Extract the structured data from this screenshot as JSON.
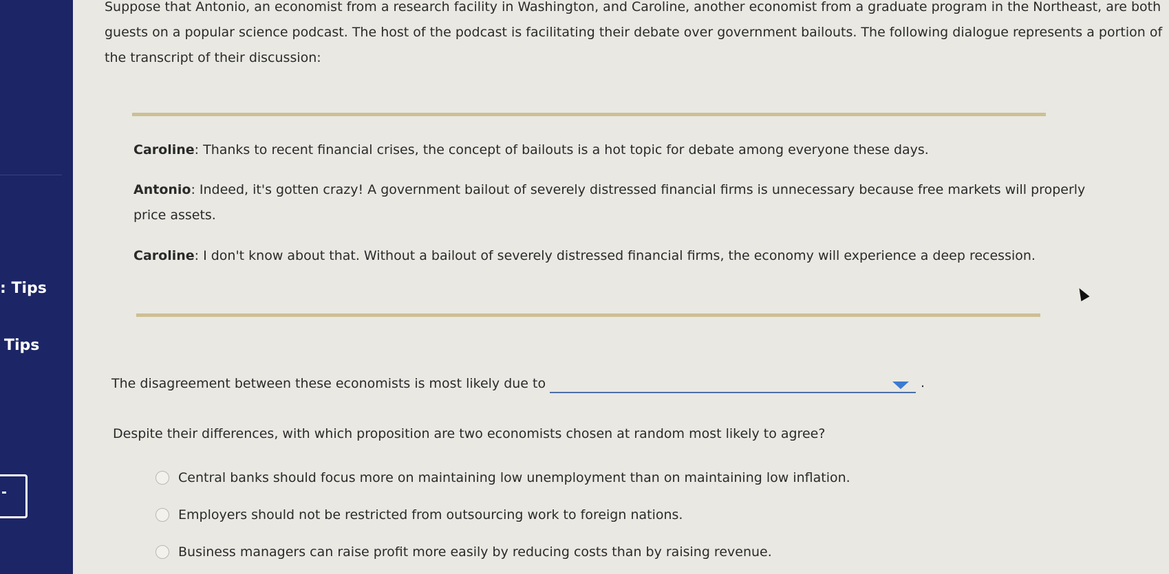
{
  "sidebar": {
    "tips_top": ": Tips",
    "tips_bottom": "Tips"
  },
  "intro": "Suppose that Antonio, an economist from a research facility in Washington, and Caroline, another economist from a graduate program in the Northeast, are both guests on a popular science podcast. The host of the podcast is facilitating their debate over government bailouts. The following dialogue represents a portion of the transcript of their discussion:",
  "dialogue": [
    {
      "speaker": "Caroline",
      "text": ": Thanks to recent financial crises, the concept of bailouts is a hot topic for debate among everyone these days."
    },
    {
      "speaker": "Antonio",
      "text": ": Indeed, it's gotten crazy! A government bailout of severely distressed financial firms is unnecessary because free markets will properly price assets."
    },
    {
      "speaker": "Caroline",
      "text": ": I don't know about that. Without a bailout of severely distressed financial firms, the economy will experience a deep recession."
    }
  ],
  "question1": {
    "prompt": "The disagreement between these economists is most likely due to",
    "selected": "",
    "period": "."
  },
  "question2": {
    "prompt": "Despite their differences, with which proposition are two economists chosen at random most likely to agree?",
    "options": [
      "Central banks should focus more on maintaining low unemployment than on maintaining low inflation.",
      "Employers should not be restricted from outsourcing work to foreign nations.",
      "Business managers can raise profit more easily by reducing costs than by raising revenue."
    ]
  },
  "colors": {
    "sidebar": "#1c2566",
    "rule": "#cdbf95",
    "dropdown_arrow": "#3d7ad0"
  }
}
